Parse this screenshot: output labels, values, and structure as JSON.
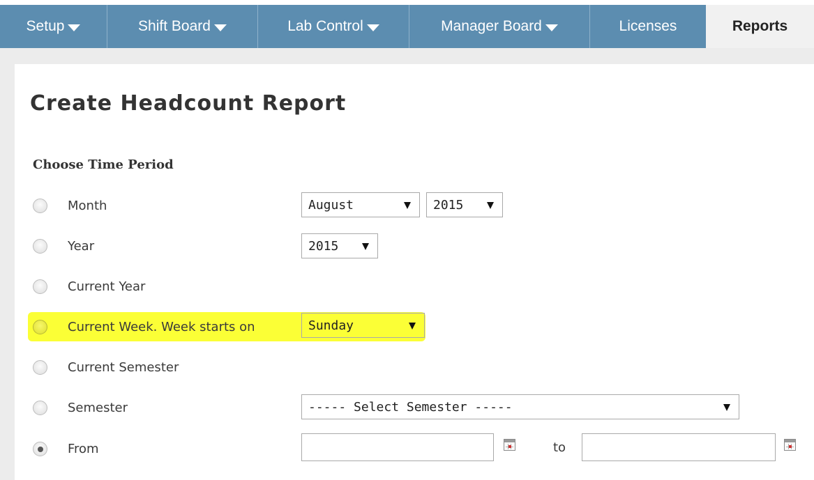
{
  "nav": {
    "tabs": [
      {
        "label": "Setup",
        "dropdown": true
      },
      {
        "label": "Shift Board",
        "dropdown": true
      },
      {
        "label": "Lab Control",
        "dropdown": true
      },
      {
        "label": "Manager Board",
        "dropdown": true
      },
      {
        "label": "Licenses",
        "dropdown": false
      },
      {
        "label": "Reports",
        "dropdown": false,
        "active": true
      }
    ]
  },
  "page": {
    "title": "Create Headcount Report",
    "section": "Choose Time Period"
  },
  "options": {
    "month": {
      "label": "Month",
      "month_value": "August",
      "year_value": "2015"
    },
    "year": {
      "label": "Year",
      "value": "2015"
    },
    "current_year": {
      "label": "Current Year"
    },
    "current_week": {
      "label": "Current Week. Week starts on",
      "value": "Sunday",
      "highlighted": true
    },
    "current_semester": {
      "label": "Current Semester"
    },
    "semester": {
      "label": "Semester",
      "value": "----- Select Semester -----"
    },
    "from": {
      "label": "From",
      "checked": true,
      "from_value": "",
      "to_label": "to",
      "to_value": ""
    }
  },
  "colors": {
    "nav_bg": "#5c8db0",
    "active_tab_bg": "#f1f1f1",
    "highlight": "#fbff25"
  },
  "icons": {
    "dropdown": "caret-down-icon",
    "calendar": "calendar-icon"
  }
}
